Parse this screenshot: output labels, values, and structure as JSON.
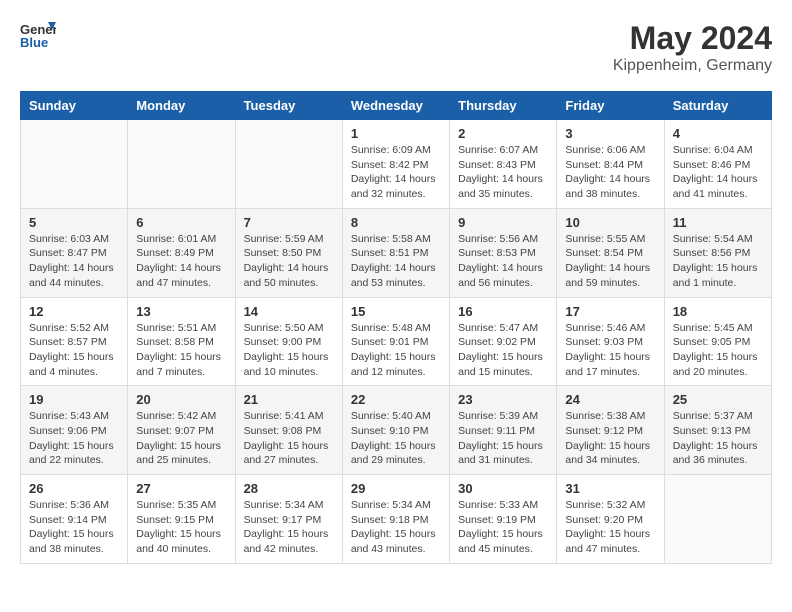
{
  "header": {
    "logo_line1": "General",
    "logo_line2": "Blue",
    "title": "May 2024",
    "subtitle": "Kippenheim, Germany"
  },
  "weekdays": [
    "Sunday",
    "Monday",
    "Tuesday",
    "Wednesday",
    "Thursday",
    "Friday",
    "Saturday"
  ],
  "weeks": [
    [
      {
        "day": "",
        "info": ""
      },
      {
        "day": "",
        "info": ""
      },
      {
        "day": "",
        "info": ""
      },
      {
        "day": "1",
        "info": "Sunrise: 6:09 AM\nSunset: 8:42 PM\nDaylight: 14 hours\nand 32 minutes."
      },
      {
        "day": "2",
        "info": "Sunrise: 6:07 AM\nSunset: 8:43 PM\nDaylight: 14 hours\nand 35 minutes."
      },
      {
        "day": "3",
        "info": "Sunrise: 6:06 AM\nSunset: 8:44 PM\nDaylight: 14 hours\nand 38 minutes."
      },
      {
        "day": "4",
        "info": "Sunrise: 6:04 AM\nSunset: 8:46 PM\nDaylight: 14 hours\nand 41 minutes."
      }
    ],
    [
      {
        "day": "5",
        "info": "Sunrise: 6:03 AM\nSunset: 8:47 PM\nDaylight: 14 hours\nand 44 minutes."
      },
      {
        "day": "6",
        "info": "Sunrise: 6:01 AM\nSunset: 8:49 PM\nDaylight: 14 hours\nand 47 minutes."
      },
      {
        "day": "7",
        "info": "Sunrise: 5:59 AM\nSunset: 8:50 PM\nDaylight: 14 hours\nand 50 minutes."
      },
      {
        "day": "8",
        "info": "Sunrise: 5:58 AM\nSunset: 8:51 PM\nDaylight: 14 hours\nand 53 minutes."
      },
      {
        "day": "9",
        "info": "Sunrise: 5:56 AM\nSunset: 8:53 PM\nDaylight: 14 hours\nand 56 minutes."
      },
      {
        "day": "10",
        "info": "Sunrise: 5:55 AM\nSunset: 8:54 PM\nDaylight: 14 hours\nand 59 minutes."
      },
      {
        "day": "11",
        "info": "Sunrise: 5:54 AM\nSunset: 8:56 PM\nDaylight: 15 hours\nand 1 minute."
      }
    ],
    [
      {
        "day": "12",
        "info": "Sunrise: 5:52 AM\nSunset: 8:57 PM\nDaylight: 15 hours\nand 4 minutes."
      },
      {
        "day": "13",
        "info": "Sunrise: 5:51 AM\nSunset: 8:58 PM\nDaylight: 15 hours\nand 7 minutes."
      },
      {
        "day": "14",
        "info": "Sunrise: 5:50 AM\nSunset: 9:00 PM\nDaylight: 15 hours\nand 10 minutes."
      },
      {
        "day": "15",
        "info": "Sunrise: 5:48 AM\nSunset: 9:01 PM\nDaylight: 15 hours\nand 12 minutes."
      },
      {
        "day": "16",
        "info": "Sunrise: 5:47 AM\nSunset: 9:02 PM\nDaylight: 15 hours\nand 15 minutes."
      },
      {
        "day": "17",
        "info": "Sunrise: 5:46 AM\nSunset: 9:03 PM\nDaylight: 15 hours\nand 17 minutes."
      },
      {
        "day": "18",
        "info": "Sunrise: 5:45 AM\nSunset: 9:05 PM\nDaylight: 15 hours\nand 20 minutes."
      }
    ],
    [
      {
        "day": "19",
        "info": "Sunrise: 5:43 AM\nSunset: 9:06 PM\nDaylight: 15 hours\nand 22 minutes."
      },
      {
        "day": "20",
        "info": "Sunrise: 5:42 AM\nSunset: 9:07 PM\nDaylight: 15 hours\nand 25 minutes."
      },
      {
        "day": "21",
        "info": "Sunrise: 5:41 AM\nSunset: 9:08 PM\nDaylight: 15 hours\nand 27 minutes."
      },
      {
        "day": "22",
        "info": "Sunrise: 5:40 AM\nSunset: 9:10 PM\nDaylight: 15 hours\nand 29 minutes."
      },
      {
        "day": "23",
        "info": "Sunrise: 5:39 AM\nSunset: 9:11 PM\nDaylight: 15 hours\nand 31 minutes."
      },
      {
        "day": "24",
        "info": "Sunrise: 5:38 AM\nSunset: 9:12 PM\nDaylight: 15 hours\nand 34 minutes."
      },
      {
        "day": "25",
        "info": "Sunrise: 5:37 AM\nSunset: 9:13 PM\nDaylight: 15 hours\nand 36 minutes."
      }
    ],
    [
      {
        "day": "26",
        "info": "Sunrise: 5:36 AM\nSunset: 9:14 PM\nDaylight: 15 hours\nand 38 minutes."
      },
      {
        "day": "27",
        "info": "Sunrise: 5:35 AM\nSunset: 9:15 PM\nDaylight: 15 hours\nand 40 minutes."
      },
      {
        "day": "28",
        "info": "Sunrise: 5:34 AM\nSunset: 9:17 PM\nDaylight: 15 hours\nand 42 minutes."
      },
      {
        "day": "29",
        "info": "Sunrise: 5:34 AM\nSunset: 9:18 PM\nDaylight: 15 hours\nand 43 minutes."
      },
      {
        "day": "30",
        "info": "Sunrise: 5:33 AM\nSunset: 9:19 PM\nDaylight: 15 hours\nand 45 minutes."
      },
      {
        "day": "31",
        "info": "Sunrise: 5:32 AM\nSunset: 9:20 PM\nDaylight: 15 hours\nand 47 minutes."
      },
      {
        "day": "",
        "info": ""
      }
    ]
  ]
}
